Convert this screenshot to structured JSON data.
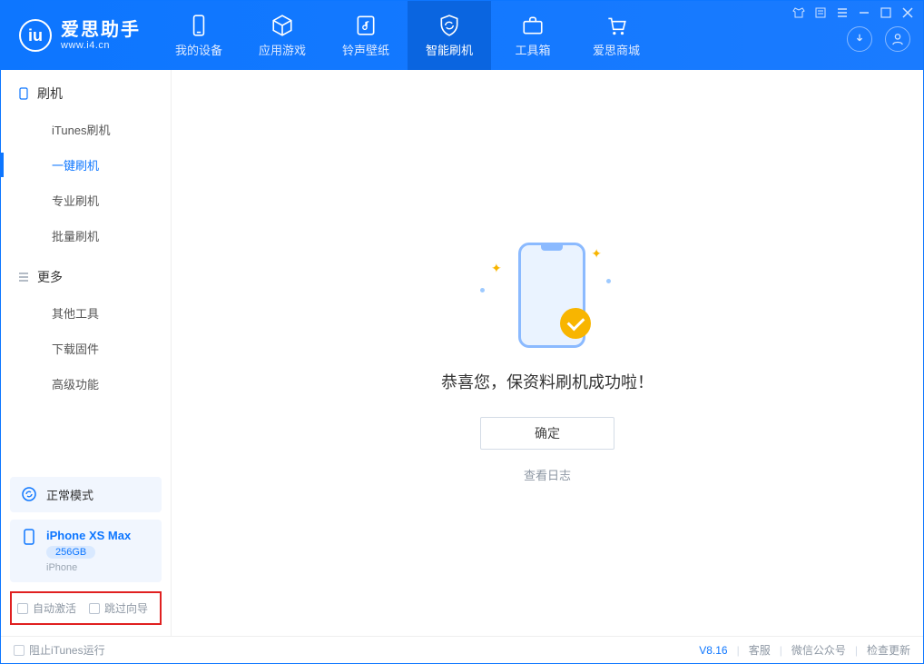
{
  "brand": {
    "name": "爱思助手",
    "url": "www.i4.cn"
  },
  "tabs": [
    {
      "id": "device",
      "label": "我的设备"
    },
    {
      "id": "apps",
      "label": "应用游戏"
    },
    {
      "id": "ringwall",
      "label": "铃声壁纸"
    },
    {
      "id": "flash",
      "label": "智能刷机",
      "active": true
    },
    {
      "id": "toolbox",
      "label": "工具箱"
    },
    {
      "id": "store",
      "label": "爱思商城"
    }
  ],
  "sidebar": {
    "group1_title": "刷机",
    "group1": [
      {
        "id": "itunes",
        "label": "iTunes刷机"
      },
      {
        "id": "onekey",
        "label": "一键刷机",
        "active": true
      },
      {
        "id": "pro",
        "label": "专业刷机"
      },
      {
        "id": "batch",
        "label": "批量刷机"
      }
    ],
    "group2_title": "更多",
    "group2": [
      {
        "id": "other",
        "label": "其他工具"
      },
      {
        "id": "firmware",
        "label": "下载固件"
      },
      {
        "id": "adv",
        "label": "高级功能"
      }
    ],
    "mode_label": "正常模式",
    "device": {
      "name": "iPhone XS Max",
      "capacity": "256GB",
      "type": "iPhone"
    },
    "opts": {
      "auto_activate": "自动激活",
      "skip_guide": "跳过向导"
    }
  },
  "main": {
    "success_text": "恭喜您，保资料刷机成功啦！",
    "ok_label": "确定",
    "view_log": "查看日志"
  },
  "footer": {
    "block_itunes": "阻止iTunes运行",
    "version": "V8.16",
    "links": [
      "客服",
      "微信公众号",
      "检查更新"
    ]
  }
}
